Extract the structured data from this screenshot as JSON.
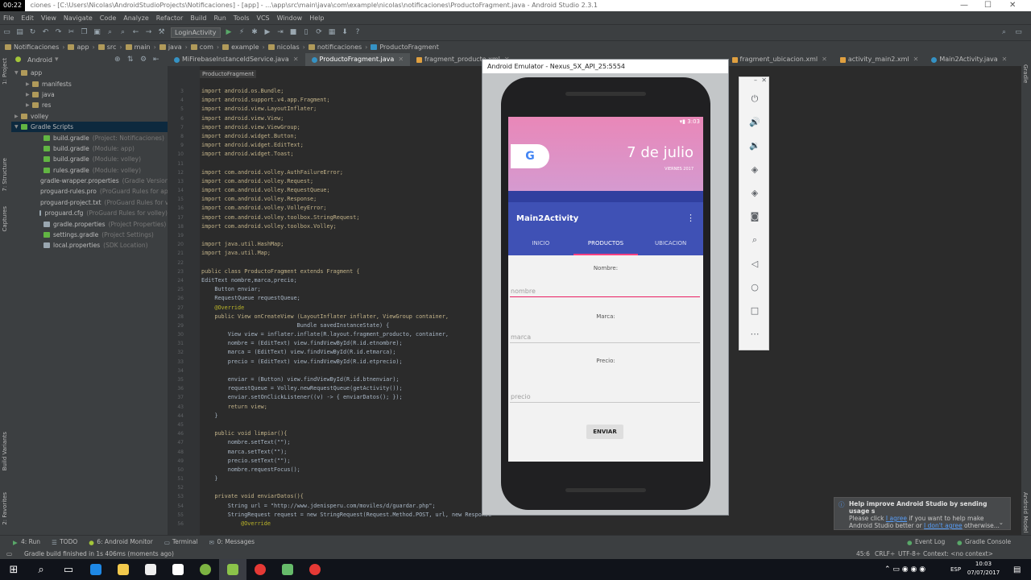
{
  "window": {
    "rec_time": "00:22",
    "title": "ciones - [C:\\Users\\Nicolas\\AndroidStudioProjects\\Notificaciones] - [app] - ...\\app\\src\\main\\java\\com\\example\\nicolas\\notificaciones\\ProductoFragment.java - Android Studio 2.3.1"
  },
  "menu": [
    "File",
    "Edit",
    "View",
    "Navigate",
    "Code",
    "Analyze",
    "Refactor",
    "Build",
    "Run",
    "Tools",
    "VCS",
    "Window",
    "Help"
  ],
  "toolbar": {
    "run_config": "LoginActivity"
  },
  "breadcrumbs": [
    "Notificaciones",
    "app",
    "src",
    "main",
    "java",
    "com",
    "example",
    "nicolas",
    "notificaciones",
    "ProductoFragment"
  ],
  "project_view": {
    "selector": "Android"
  },
  "editor_tabs": [
    {
      "label": "MiFirebaseInstanceIdService.java",
      "active": false
    },
    {
      "label": "ProductoFragment.java",
      "active": true
    },
    {
      "label": "fragment_producto.xml",
      "active": false
    },
    {
      "label": "fragment_ubicacion.xml",
      "active": false
    },
    {
      "label": "activity_main2.xml",
      "active": false
    },
    {
      "label": "Main2Activity.java",
      "active": false
    }
  ],
  "tree": [
    {
      "label": "app",
      "note": "",
      "indent": 0,
      "arrow": "▼",
      "color": "#b09a5a",
      "selected": false
    },
    {
      "label": "manifests",
      "note": "",
      "indent": 1,
      "arrow": "▶",
      "color": "#b09a5a",
      "selected": false
    },
    {
      "label": "java",
      "note": "",
      "indent": 1,
      "arrow": "▶",
      "color": "#b09a5a",
      "selected": false
    },
    {
      "label": "res",
      "note": "",
      "indent": 1,
      "arrow": "▶",
      "color": "#b09a5a",
      "selected": false
    },
    {
      "label": "volley",
      "note": "",
      "indent": 0,
      "arrow": "▶",
      "color": "#b09a5a",
      "selected": false
    },
    {
      "label": "Gradle Scripts",
      "note": "",
      "indent": 0,
      "arrow": "▼",
      "color": "#62b543",
      "selected": true
    },
    {
      "label": "build.gradle",
      "note": "(Project: Notificaciones)",
      "indent": 2,
      "arrow": "",
      "color": "#62b543",
      "selected": false
    },
    {
      "label": "build.gradle",
      "note": "(Module: app)",
      "indent": 2,
      "arrow": "",
      "color": "#62b543",
      "selected": false
    },
    {
      "label": "build.gradle",
      "note": "(Module: volley)",
      "indent": 2,
      "arrow": "",
      "color": "#62b543",
      "selected": false
    },
    {
      "label": "rules.gradle",
      "note": "(Module: volley)",
      "indent": 2,
      "arrow": "",
      "color": "#62b543",
      "selected": false
    },
    {
      "label": "gradle-wrapper.properties",
      "note": "(Gradle Version)",
      "indent": 2,
      "arrow": "",
      "color": "#9aa7b0",
      "selected": false
    },
    {
      "label": "proguard-rules.pro",
      "note": "(ProGuard Rules for app)",
      "indent": 2,
      "arrow": "",
      "color": "#9aa7b0",
      "selected": false
    },
    {
      "label": "proguard-project.txt",
      "note": "(ProGuard Rules for volley)",
      "indent": 2,
      "arrow": "",
      "color": "#9aa7b0",
      "selected": false
    },
    {
      "label": "proguard.cfg",
      "note": "(ProGuard Rules for volley)",
      "indent": 2,
      "arrow": "",
      "color": "#9aa7b0",
      "selected": false
    },
    {
      "label": "gradle.properties",
      "note": "(Project Properties)",
      "indent": 2,
      "arrow": "",
      "color": "#9aa7b0",
      "selected": false
    },
    {
      "label": "settings.gradle",
      "note": "(Project Settings)",
      "indent": 2,
      "arrow": "",
      "color": "#62b543",
      "selected": false
    },
    {
      "label": "local.properties",
      "note": "(SDK Location)",
      "indent": 2,
      "arrow": "",
      "color": "#9aa7b0",
      "selected": false
    }
  ],
  "editor": {
    "breadcrumb": "ProductoFragment"
  },
  "code_lines": [
    {
      "n": "3",
      "t": "import android.os.Bundle;",
      "c": "imp"
    },
    {
      "n": "4",
      "t": "import android.support.v4.app.Fragment;",
      "c": "imp"
    },
    {
      "n": "5",
      "t": "import android.view.LayoutInflater;",
      "c": "imp"
    },
    {
      "n": "6",
      "t": "import android.view.View;",
      "c": "imp"
    },
    {
      "n": "7",
      "t": "import android.view.ViewGroup;",
      "c": "imp"
    },
    {
      "n": "8",
      "t": "import android.widget.Button;",
      "c": "imp"
    },
    {
      "n": "9",
      "t": "import android.widget.EditText;",
      "c": "imp"
    },
    {
      "n": "10",
      "t": "import android.widget.Toast;",
      "c": "imp"
    },
    {
      "n": "11",
      "t": "",
      "c": "plain"
    },
    {
      "n": "12",
      "t": "import com.android.volley.AuthFailureError;",
      "c": "imp"
    },
    {
      "n": "13",
      "t": "import com.android.volley.Request;",
      "c": "imp"
    },
    {
      "n": "14",
      "t": "import com.android.volley.RequestQueue;",
      "c": "imp"
    },
    {
      "n": "15",
      "t": "import com.android.volley.Response;",
      "c": "imp"
    },
    {
      "n": "16",
      "t": "import com.android.volley.VolleyError;",
      "c": "imp"
    },
    {
      "n": "17",
      "t": "import com.android.volley.toolbox.StringRequest;",
      "c": "imp"
    },
    {
      "n": "18",
      "t": "import com.android.volley.toolbox.Volley;",
      "c": "imp"
    },
    {
      "n": "19",
      "t": "",
      "c": "plain"
    },
    {
      "n": "20",
      "t": "import java.util.HashMap;",
      "c": "imp"
    },
    {
      "n": "21",
      "t": "import java.util.Map;",
      "c": "imp"
    },
    {
      "n": "22",
      "t": "",
      "c": "plain"
    },
    {
      "n": "23",
      "t": "public class ProductoFragment extends Fragment {",
      "c": "kwline"
    },
    {
      "n": "24",
      "t": "EditText nombre,marca,precio;",
      "c": "plain"
    },
    {
      "n": "25",
      "t": "    Button enviar;",
      "c": "plain"
    },
    {
      "n": "26",
      "t": "    RequestQueue requestQueue;",
      "c": "plain"
    },
    {
      "n": "27",
      "t": "    @Override",
      "c": "ann"
    },
    {
      "n": "28",
      "t": "    public View onCreateView (LayoutInflater inflater, ViewGroup container,",
      "c": "kwline"
    },
    {
      "n": "29",
      "t": "                             Bundle savedInstanceState) {",
      "c": "plain"
    },
    {
      "n": "30",
      "t": "        View view = inflater.inflate(R.layout.fragment_producto, container,",
      "c": "plain"
    },
    {
      "n": "31",
      "t": "        nombre = (EditText) view.findViewById(R.id.etnombre);",
      "c": "plain"
    },
    {
      "n": "32",
      "t": "        marca = (EditText) view.findViewById(R.id.etmarca);",
      "c": "plain"
    },
    {
      "n": "33",
      "t": "        precio = (EditText) view.findViewById(R.id.etprecio);",
      "c": "plain"
    },
    {
      "n": "34",
      "t": "",
      "c": "plain"
    },
    {
      "n": "35",
      "t": "        enviar = (Button) view.findViewById(R.id.btnenviar);",
      "c": "plain"
    },
    {
      "n": "36",
      "t": "        requestQueue = Volley.newRequestQueue(getActivity());",
      "c": "plain"
    },
    {
      "n": "37",
      "t": "        enviar.setOnClickListener((v) -> { enviarDatos(); });",
      "c": "plain"
    },
    {
      "n": "43",
      "t": "        return view;",
      "c": "kwline"
    },
    {
      "n": "44",
      "t": "    }",
      "c": "plain"
    },
    {
      "n": "45",
      "t": "",
      "c": "plain"
    },
    {
      "n": "46",
      "t": "    public void limpiar(){",
      "c": "kwline"
    },
    {
      "n": "47",
      "t": "        nombre.setText(\"\");",
      "c": "plain"
    },
    {
      "n": "48",
      "t": "        marca.setText(\"\");",
      "c": "plain"
    },
    {
      "n": "49",
      "t": "        precio.setText(\"\");",
      "c": "plain"
    },
    {
      "n": "50",
      "t": "        nombre.requestFocus();",
      "c": "plain"
    },
    {
      "n": "51",
      "t": "    }",
      "c": "plain"
    },
    {
      "n": "52",
      "t": "",
      "c": "plain"
    },
    {
      "n": "53",
      "t": "    private void enviarDatos(){",
      "c": "kwline"
    },
    {
      "n": "54",
      "t": "        String url = \"http://www.jdenisperu.com/moviles/d/guardar.php\";",
      "c": "plain"
    },
    {
      "n": "55",
      "t": "        StringRequest request = new StringRequest(Request.Method.POST, url, new Response.Listener<String>() {",
      "c": "plain"
    },
    {
      "n": "56",
      "t": "            @Override",
      "c": "ann"
    }
  ],
  "emulator": {
    "title": "Android Emulator - Nexus_5X_API_25:5554",
    "clock": "3:03",
    "date": "7 de julio",
    "weekday": "VIERNES 2017",
    "app_title": "Main2Activity",
    "tabs": [
      "INICIO",
      "PRODUCTOS",
      "UBICACION"
    ],
    "active_tab": "PRODUCTOS",
    "fields": [
      {
        "label": "Nombre:",
        "placeholder": "nombre"
      },
      {
        "label": "Marca:",
        "placeholder": "marca"
      },
      {
        "label": "Precio:",
        "placeholder": "precio"
      }
    ],
    "button": "ENVIAR"
  },
  "bottom_tools": [
    "4: Run",
    "TODO",
    "6: Android Monitor",
    "Terminal",
    "0: Messages",
    "Event Log",
    "Gradle Console"
  ],
  "status": {
    "message": "Gradle build finished in 1s 406ms (moments ago)",
    "position": "45:6",
    "line_sep": "CRLF÷",
    "encoding": "UTF-8÷",
    "context": "Context: <no context>"
  },
  "notification": {
    "title": "Help improve Android Studio by sending usage s",
    "line1_pre": "Please click ",
    "agree": "I agree",
    "line1_post": " if you want to help make",
    "line2_pre": "Android Studio better or ",
    "dont_agree": "I don't agree",
    "line2_post": " otherwise..."
  },
  "taskbar": {
    "time": "10:03",
    "date": "07/07/2017",
    "lang": "ESP"
  },
  "side_strips": {
    "left": [
      "1: Project",
      "7: Structure",
      "Captures",
      "Build Variants",
      "2: Favorites"
    ],
    "right": [
      "Gradle",
      "Android Model"
    ]
  }
}
